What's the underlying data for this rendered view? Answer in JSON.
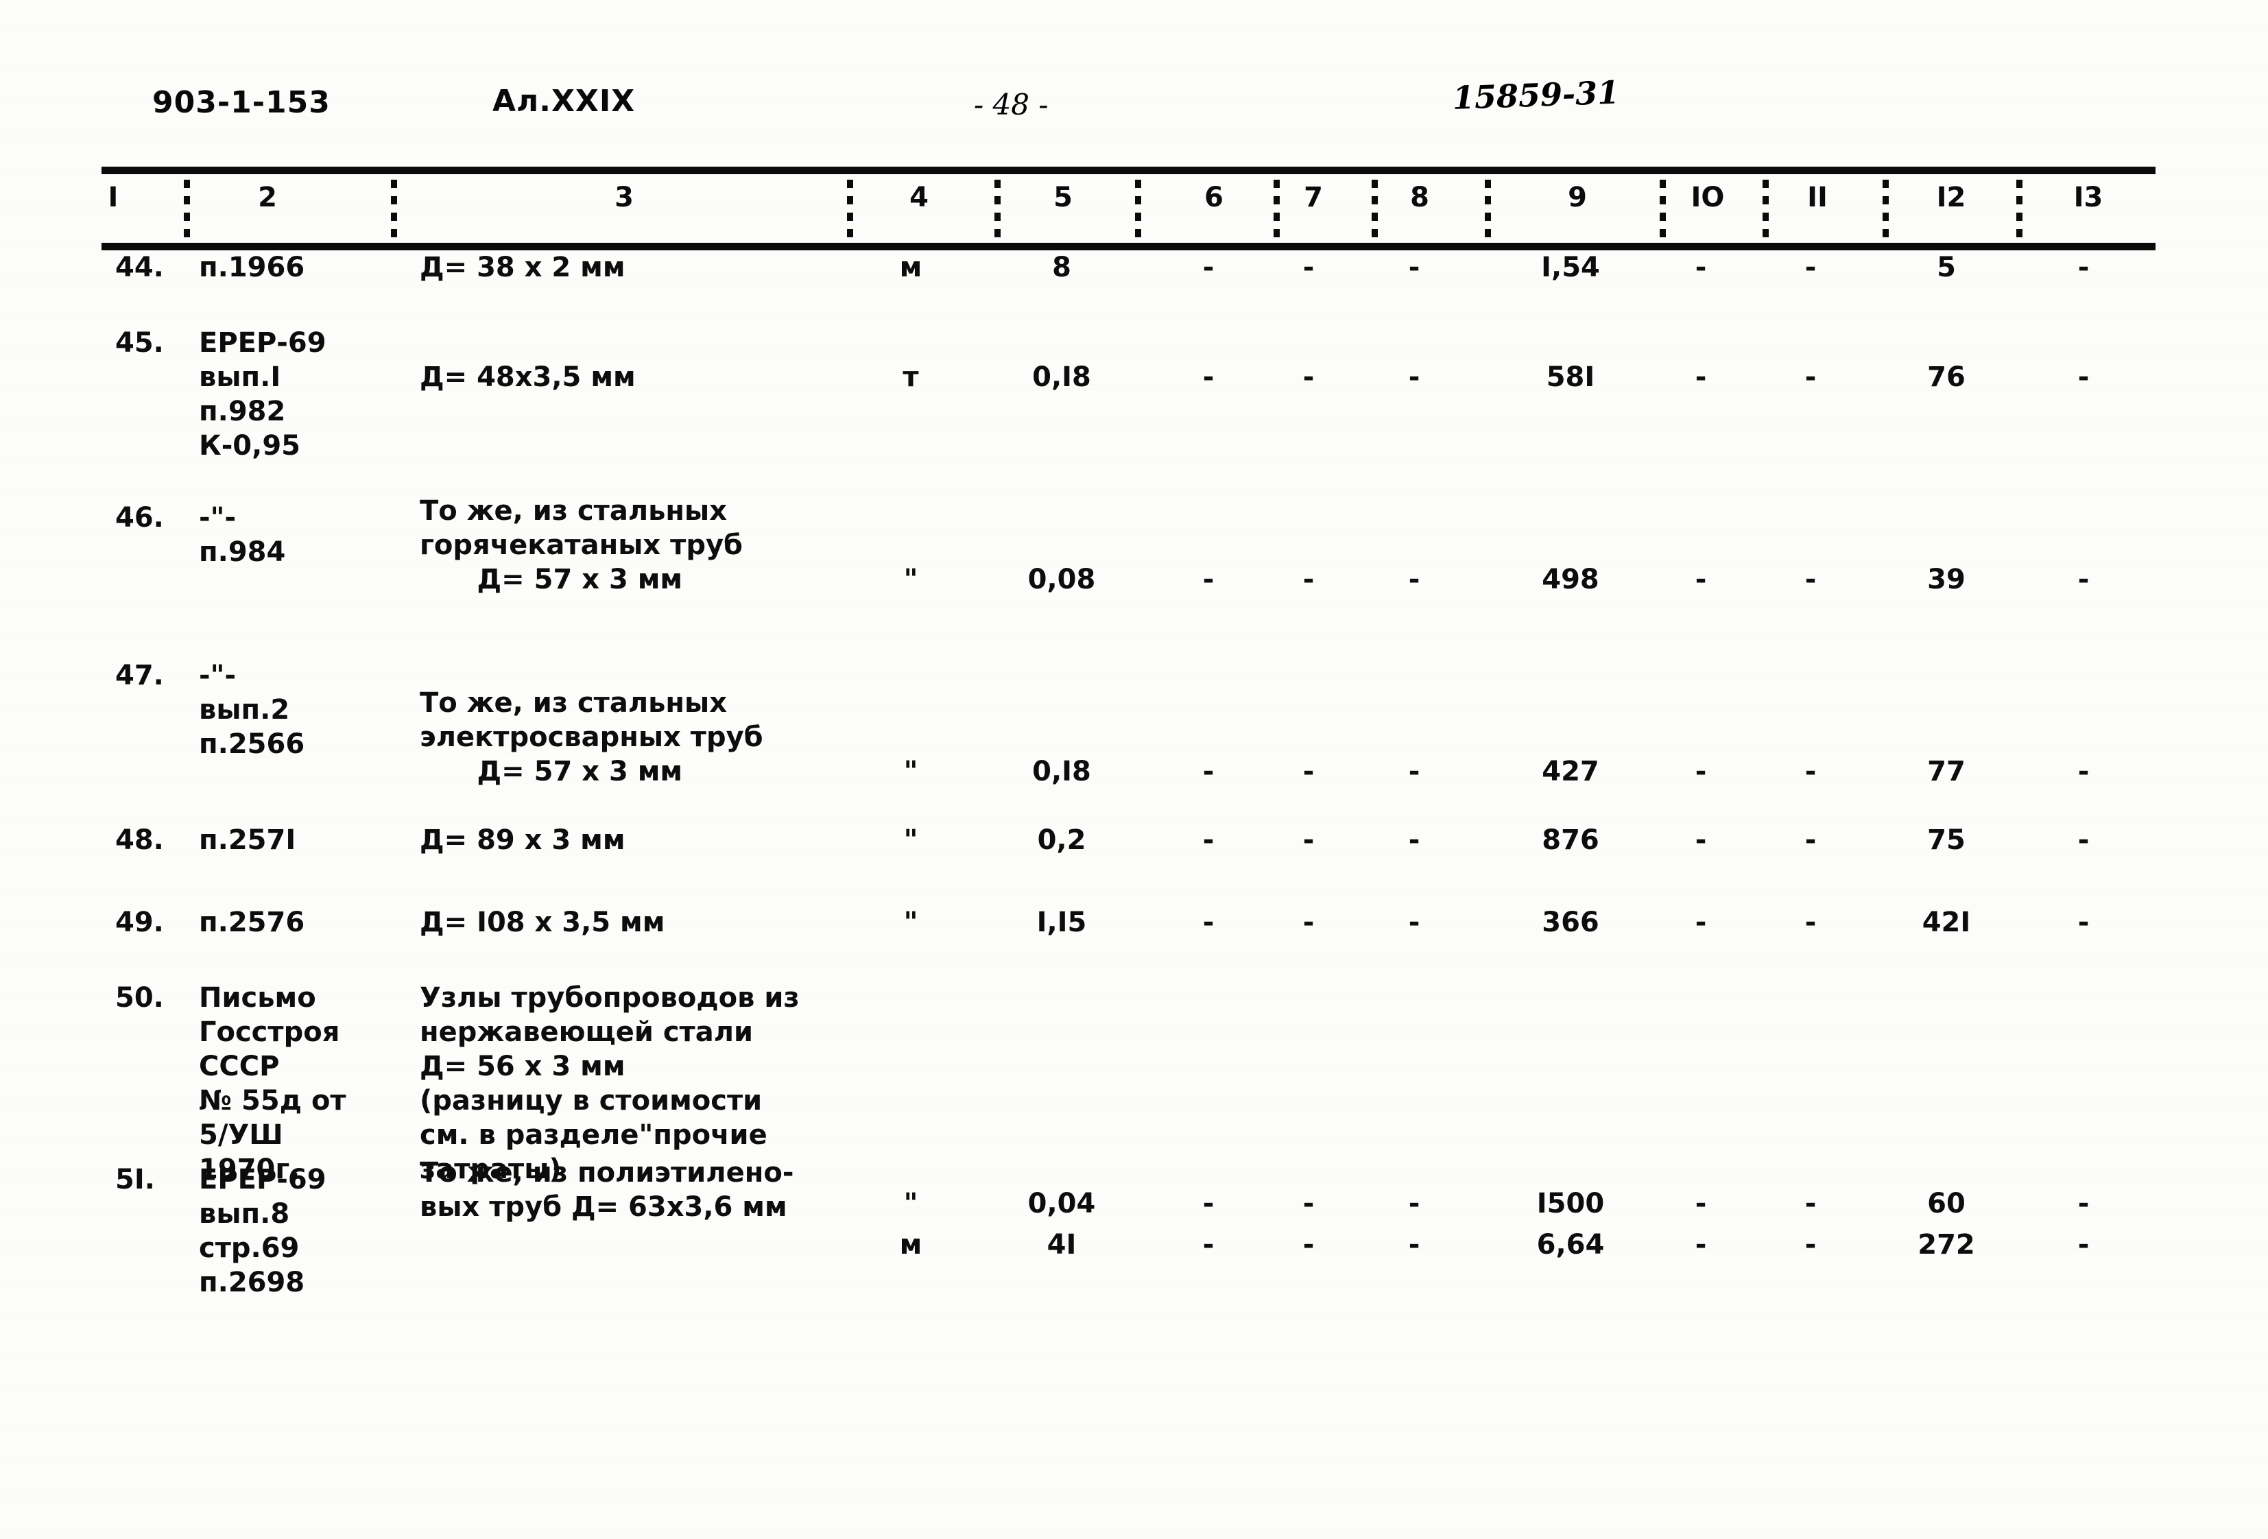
{
  "header": {
    "doc_code": "903-1-153",
    "album_code": "Ал.XXIX",
    "page_number": "- 48 -",
    "archive_number": "15859-31"
  },
  "table": {
    "column_headers": [
      "I",
      "2",
      "3",
      "4",
      "5",
      "6",
      "7",
      "8",
      "9",
      "IO",
      "II",
      "I2",
      "I3"
    ],
    "rows": [
      {
        "num": "44.",
        "code": "п.1966",
        "desc": "Д= 38 х 2 мм",
        "c4": "м",
        "c5": "8",
        "c6": "-",
        "c7": "-",
        "c8": "-",
        "c9": "I,54",
        "c10": "-",
        "c11": "-",
        "c12": "5",
        "c13": "-"
      },
      {
        "num": "45.",
        "code": "ЕРЕР-69\nвып.I\nп.982\nК-0,95",
        "desc": "Д= 48х3,5 мм",
        "c4": "т",
        "c5": "0,I8",
        "c6": "-",
        "c7": "-",
        "c8": "-",
        "c9": "58I",
        "c10": "-",
        "c11": "-",
        "c12": "76",
        "c13": "-"
      },
      {
        "num": "46.",
        "code": "-\"-\nп.984",
        "desc": "То же, из стальных\nгорячекатаных труб\n      Д= 57 х 3 мм",
        "c4": "\"",
        "c5": "0,08",
        "c6": "-",
        "c7": "-",
        "c8": "-",
        "c9": "498",
        "c10": "-",
        "c11": "-",
        "c12": "39",
        "c13": "-"
      },
      {
        "num": "47.",
        "code": "-\"-\nвып.2\nп.2566",
        "desc": "То же, из стальных\nэлектросварных труб\n      Д= 57 х 3 мм",
        "c4": "\"",
        "c5": "0,I8",
        "c6": "-",
        "c7": "-",
        "c8": "-",
        "c9": "427",
        "c10": "-",
        "c11": "-",
        "c12": "77",
        "c13": "-"
      },
      {
        "num": "48.",
        "code": "п.257I",
        "desc": "Д= 89 х 3 мм",
        "c4": "\"",
        "c5": "0,2",
        "c6": "-",
        "c7": "-",
        "c8": "-",
        "c9": "876",
        "c10": "-",
        "c11": "-",
        "c12": "75",
        "c13": "-"
      },
      {
        "num": "49.",
        "code": "п.2576",
        "desc": "Д= I08 х 3,5 мм",
        "c4": "\"",
        "c5": "I,I5",
        "c6": "-",
        "c7": "-",
        "c8": "-",
        "c9": "366",
        "c10": "-",
        "c11": "-",
        "c12": "42I",
        "c13": "-"
      },
      {
        "num": "50.",
        "code": "Письмо\nГосстроя\nСССР\n№ 55д от\n5/УШ\n1970г.",
        "desc": "Узлы трубопроводов из\nнержавеющей стали\nД= 56 х 3 мм\n(разницу в стоимости\nсм. в разделе\"прочие\nзатраты)",
        "c4": "\"",
        "c5": "0,04",
        "c6": "-",
        "c7": "-",
        "c8": "-",
        "c9": "I500",
        "c10": "-",
        "c11": "-",
        "c12": "60",
        "c13": "-"
      },
      {
        "num": "5I.",
        "code": "ЕРЕР-69\nвып.8\nстр.69\nп.2698",
        "desc": "То же, из полиэтилено-\nвых труб Д= 63х3,6 мм",
        "c4": "м",
        "c5": "4I",
        "c6": "-",
        "c7": "-",
        "c8": "-",
        "c9": "6,64",
        "c10": "-",
        "c11": "-",
        "c12": "272",
        "c13": "-"
      }
    ]
  },
  "layout": {
    "col_header_x": [
      165,
      390,
      910,
      1340,
      1550,
      1770,
      1915,
      2070,
      2300,
      2490,
      2650,
      2845,
      3045
    ],
    "separator_x": [
      268,
      570,
      1235,
      1450,
      1655,
      1857,
      2000,
      2165,
      2420,
      2570,
      2745,
      2940
    ],
    "col_value_x": {
      "num": 168,
      "code": 290,
      "desc": 612,
      "c4": 1328,
      "c5": 1548,
      "c6": 1762,
      "c7": 1908,
      "c8": 2062,
      "c9": 2290,
      "c10": 2480,
      "c11": 2640,
      "c12": 2838,
      "c13": 3038
    },
    "row_tops": [
      {
        "num": 0,
        "code": 0,
        "desc": 0,
        "val": 0
      },
      {
        "num": 110,
        "code": 110,
        "desc": 160,
        "val": 160
      },
      {
        "num": 365,
        "code": 365,
        "desc": 355,
        "val": 455
      },
      {
        "num": 595,
        "code": 595,
        "desc": 635,
        "val": 735
      },
      {
        "num": 835,
        "code": 835,
        "desc": 835,
        "val": 835
      },
      {
        "num": 955,
        "code": 955,
        "desc": 955,
        "val": 955
      },
      {
        "num": 1065,
        "code": 1065,
        "desc": 1065,
        "val": 1365
      },
      {
        "num": 1330,
        "code": 1330,
        "desc": 1320,
        "val": 1425
      }
    ]
  }
}
